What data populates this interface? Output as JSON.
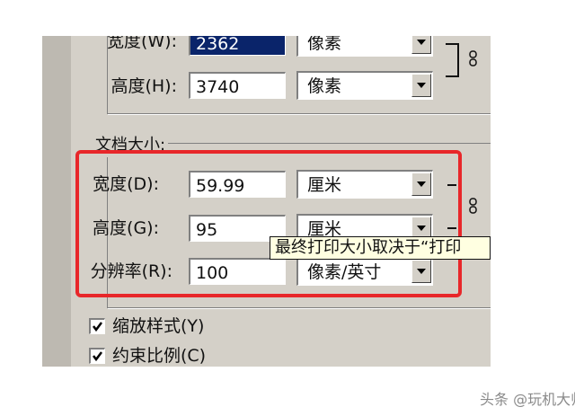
{
  "pixel_dimensions": {
    "width": {
      "label": "宽度(W):",
      "value": "2362",
      "unit": "像素"
    },
    "height": {
      "label": "高度(H):",
      "value": "3740",
      "unit": "像素"
    }
  },
  "document_size": {
    "legend": "文档大小:",
    "width": {
      "label": "宽度(D):",
      "value": "59.99",
      "unit": "厘米"
    },
    "height": {
      "label": "高度(G):",
      "value": "95",
      "unit": "厘米"
    },
    "resolution": {
      "label": "分辨率(R):",
      "value": "100",
      "unit": "像素/英寸"
    }
  },
  "options": {
    "scale_styles": {
      "label": "缩放样式(Y)",
      "checked": true
    },
    "constrain_proportions": {
      "label": "约束比例(C)",
      "checked": true
    }
  },
  "tooltip": "最终打印大小取决于“打印",
  "watermark": "头条 @玩机大师",
  "colors": {
    "highlight": "#e8272a",
    "tooltip_bg": "#ffffe1",
    "dialog_bg": "#d4d0c8"
  }
}
